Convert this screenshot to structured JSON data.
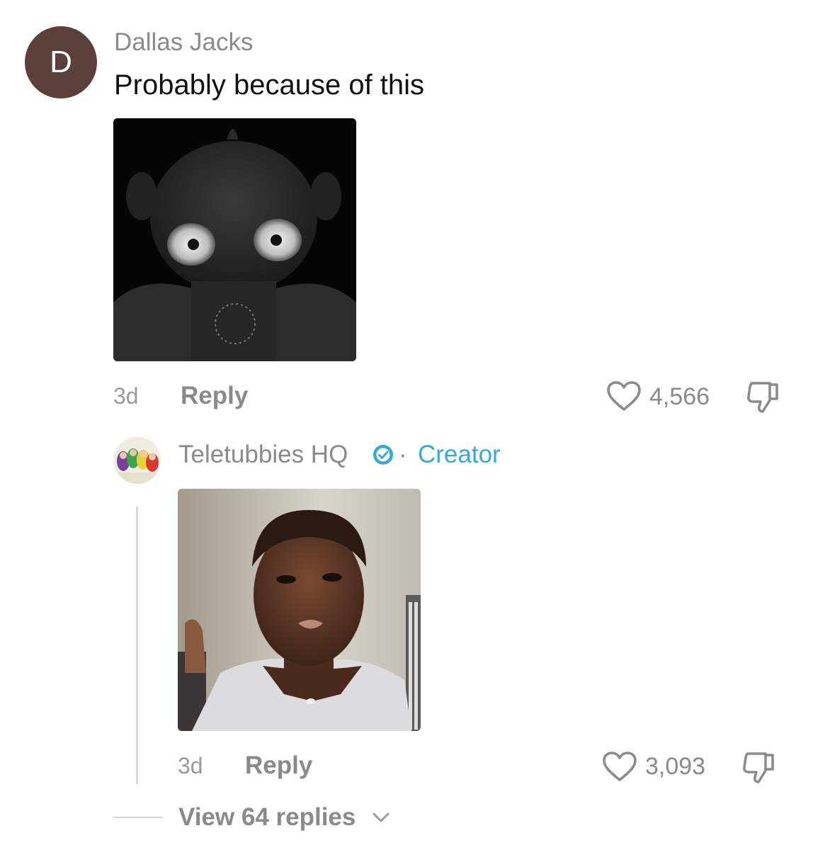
{
  "comment": {
    "avatar_letter": "D",
    "username": "Dallas Jacks",
    "text": "Probably because of this",
    "time": "3d",
    "reply_label": "Reply",
    "likes": "4,566"
  },
  "creator_reply": {
    "username": "Teletubbies HQ",
    "separator": "·",
    "badge": "Creator",
    "time": "3d",
    "reply_label": "Reply",
    "likes": "3,093"
  },
  "view_replies": "View 64 replies",
  "colors": {
    "avatar_bg": "#5a4038",
    "creator_blue": "#3aa8d6",
    "muted_text": "#8a8a8a"
  },
  "icons": [
    "heart-icon",
    "dislike-icon",
    "verified-icon",
    "chevron-down-icon"
  ]
}
